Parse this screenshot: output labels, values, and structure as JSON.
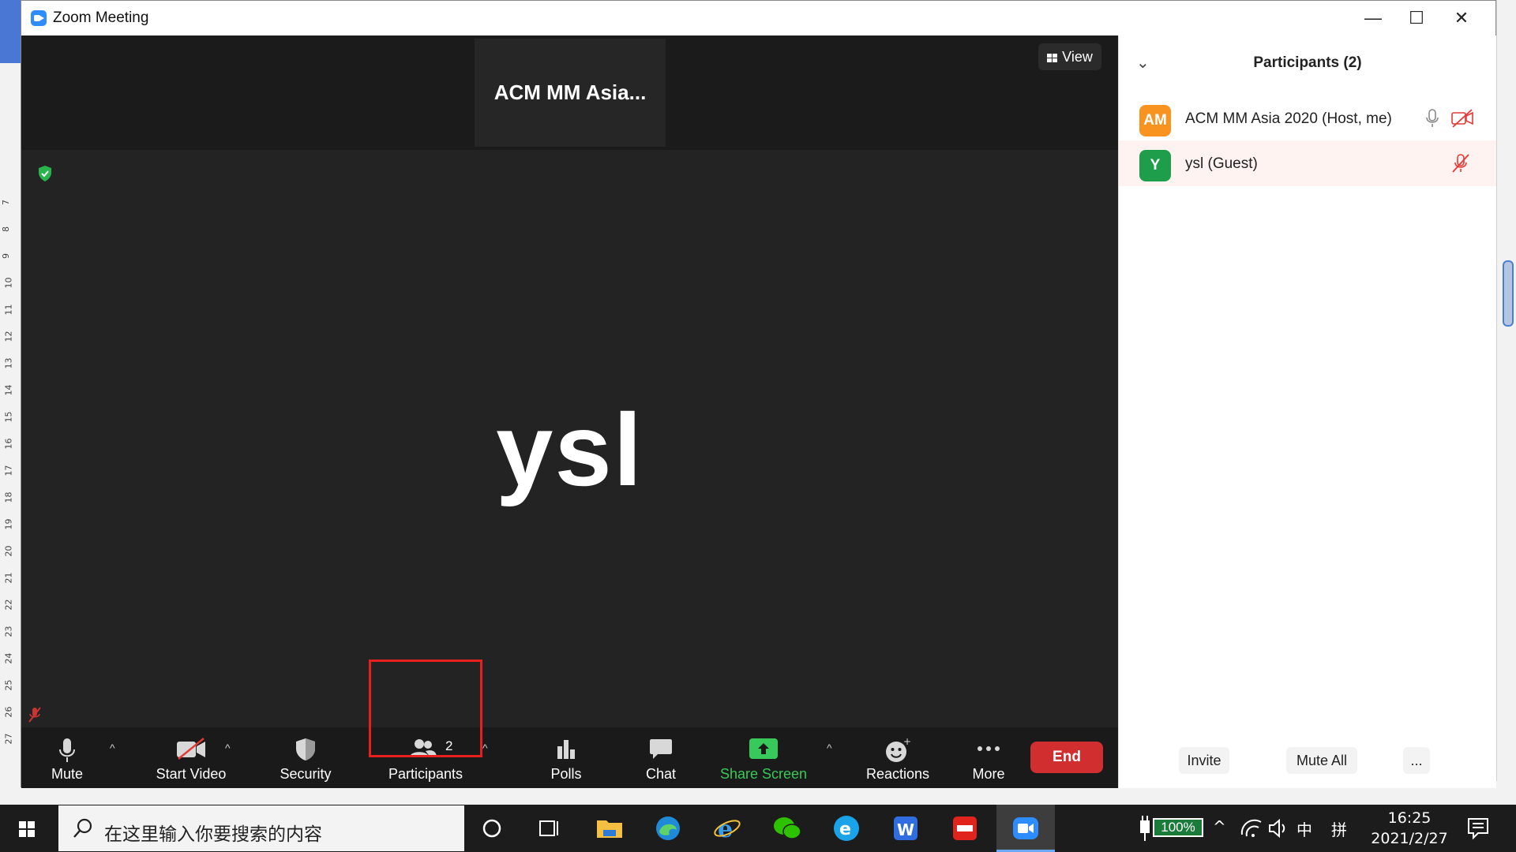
{
  "window": {
    "title": "Zoom Meeting"
  },
  "meeting": {
    "thumbnail_name": "ACM  MM  Asia...",
    "view_label": "View",
    "active_speaker": "ysl"
  },
  "toolbar": {
    "mute": "Mute",
    "start_video": "Start Video",
    "security": "Security",
    "participants": "Participants",
    "participants_count": "2",
    "polls": "Polls",
    "chat": "Chat",
    "share_screen": "Share Screen",
    "reactions": "Reactions",
    "more": "More",
    "end": "End"
  },
  "panel": {
    "title": "Participants (2)",
    "participants": [
      {
        "initials": "AM",
        "name": "ACM MM Asia 2020 (Host, me)",
        "avatar_color": "#f7931e"
      },
      {
        "initials": "Y",
        "name": "ysl (Guest)",
        "avatar_color": "#1e9e4a"
      }
    ],
    "invite": "Invite",
    "mute_all": "Mute All",
    "more": "..."
  },
  "taskbar": {
    "search_placeholder": "在这里输入你要搜索的内容",
    "battery": "100%",
    "ime_lang": "中",
    "ime_mode": "拼",
    "time": "16:25",
    "date": "2021/2/27"
  },
  "colors": {
    "zoom_blue": "#2d8cff",
    "end_red": "#d12f2f",
    "share_green": "#37c95a",
    "highlight_red": "#e8201d"
  }
}
